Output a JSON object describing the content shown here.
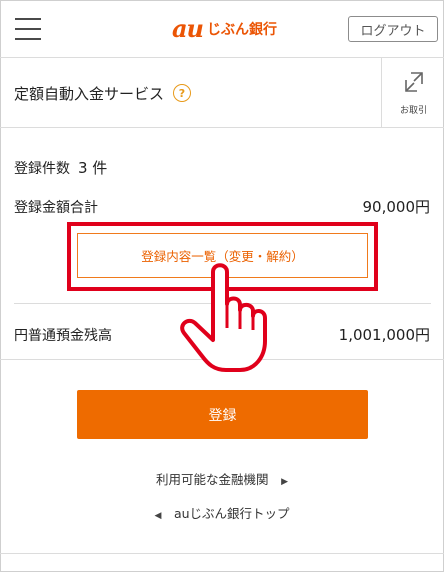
{
  "header": {
    "logo_mark": "au",
    "logo_text": "じぶん銀行",
    "logout_label": "ログアウト",
    "menu_icon": "hamburger-menu-icon"
  },
  "service": {
    "title": "定額自動入金サービス",
    "help_symbol": "?",
    "transfer_label": "お取引",
    "transfer_icon": "swap-arrows-icon"
  },
  "summary": {
    "count_label": "登録件数",
    "count_value": "3 件",
    "total_label": "登録金額合計",
    "total_value": "90,000円"
  },
  "list_button_label": "登録内容一覧（変更・解約）",
  "balance": {
    "label": "円普通預金残高",
    "value": "1,001,000円"
  },
  "register_button_label": "登録",
  "links": {
    "banks": "利用可能な金融機関",
    "top": "auじぶん銀行トップ"
  },
  "colors": {
    "accent_orange": "#ee6b00",
    "highlight_red": "#e0001b"
  }
}
